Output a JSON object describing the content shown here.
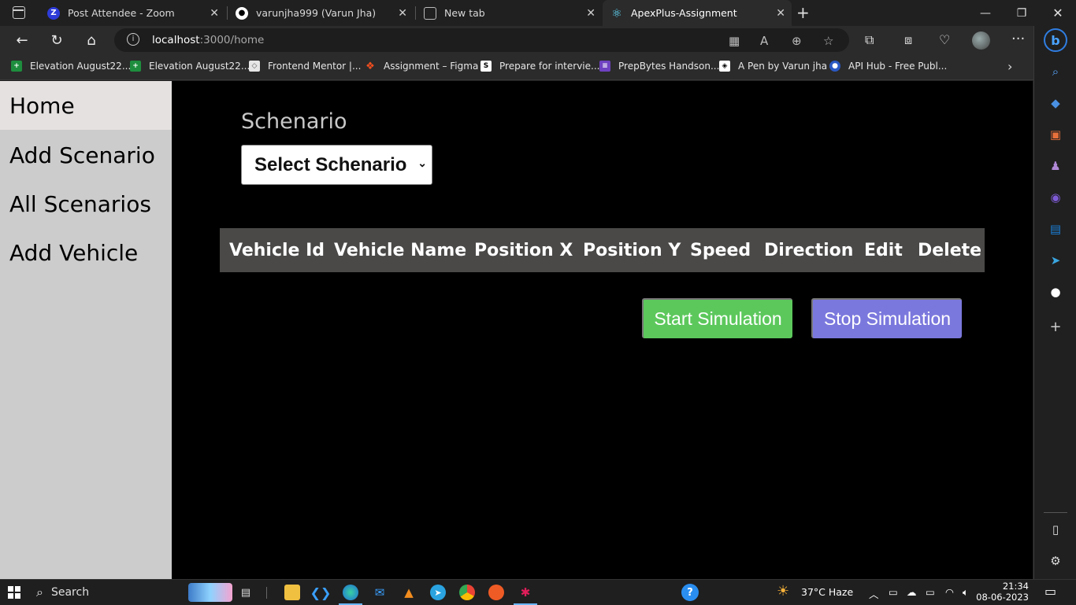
{
  "browser": {
    "tabs": [
      {
        "title": "Post Attendee - Zoom",
        "favicon": "zoom-icon",
        "active": false
      },
      {
        "title": "varunjha999 (Varun Jha)",
        "favicon": "github-icon",
        "active": false
      },
      {
        "title": "New tab",
        "favicon": "newtab-icon",
        "active": false
      },
      {
        "title": "ApexPlus-Assignment",
        "favicon": "react-icon",
        "active": true
      }
    ],
    "address": {
      "host": "localhost",
      "rest": ":3000/home"
    },
    "bookmarks": [
      {
        "label": "Elevation August22...",
        "icon": "sheets-icon",
        "color": "#1e8e3e"
      },
      {
        "label": "Elevation August22...",
        "icon": "sheets-icon",
        "color": "#1e8e3e"
      },
      {
        "label": "Frontend Mentor |...",
        "icon": "frontendmentor-icon",
        "color": "#e6e6e6"
      },
      {
        "label": "Assignment – Figma",
        "icon": "figma-icon",
        "color": "#f24e1e"
      },
      {
        "label": "Prepare for intervie...",
        "icon": "scaler-icon",
        "color": "#ffffff"
      },
      {
        "label": "PrepBytes Handson...",
        "icon": "prepbytes-icon",
        "color": "#6f42c1"
      },
      {
        "label": "A Pen by Varun jha",
        "icon": "codepen-icon",
        "color": "#ffffff"
      },
      {
        "label": "API Hub - Free Publ...",
        "icon": "apihub-icon",
        "color": "#2b59c3"
      }
    ]
  },
  "app": {
    "nav": [
      {
        "label": "Home",
        "active": true
      },
      {
        "label": "Add Scenario",
        "active": false
      },
      {
        "label": "All Scenarios",
        "active": false
      },
      {
        "label": "Add Vehicle",
        "active": false
      }
    ],
    "schenario_label": "Schenario",
    "select_value": "Select Schenario",
    "table_headers": [
      "Vehicle Id",
      "Vehicle Name",
      "Position X",
      "Position Y",
      "Speed",
      "Direction",
      "Edit",
      "Delete"
    ],
    "start_button": "Start Simulation",
    "stop_button": "Stop Simulation",
    "start_color": "#5cc85c",
    "stop_color": "#7b78dd"
  },
  "taskbar": {
    "search_label": "Search",
    "weather": "37°C  Haze",
    "time": "21:34",
    "date": "08-06-2023"
  }
}
